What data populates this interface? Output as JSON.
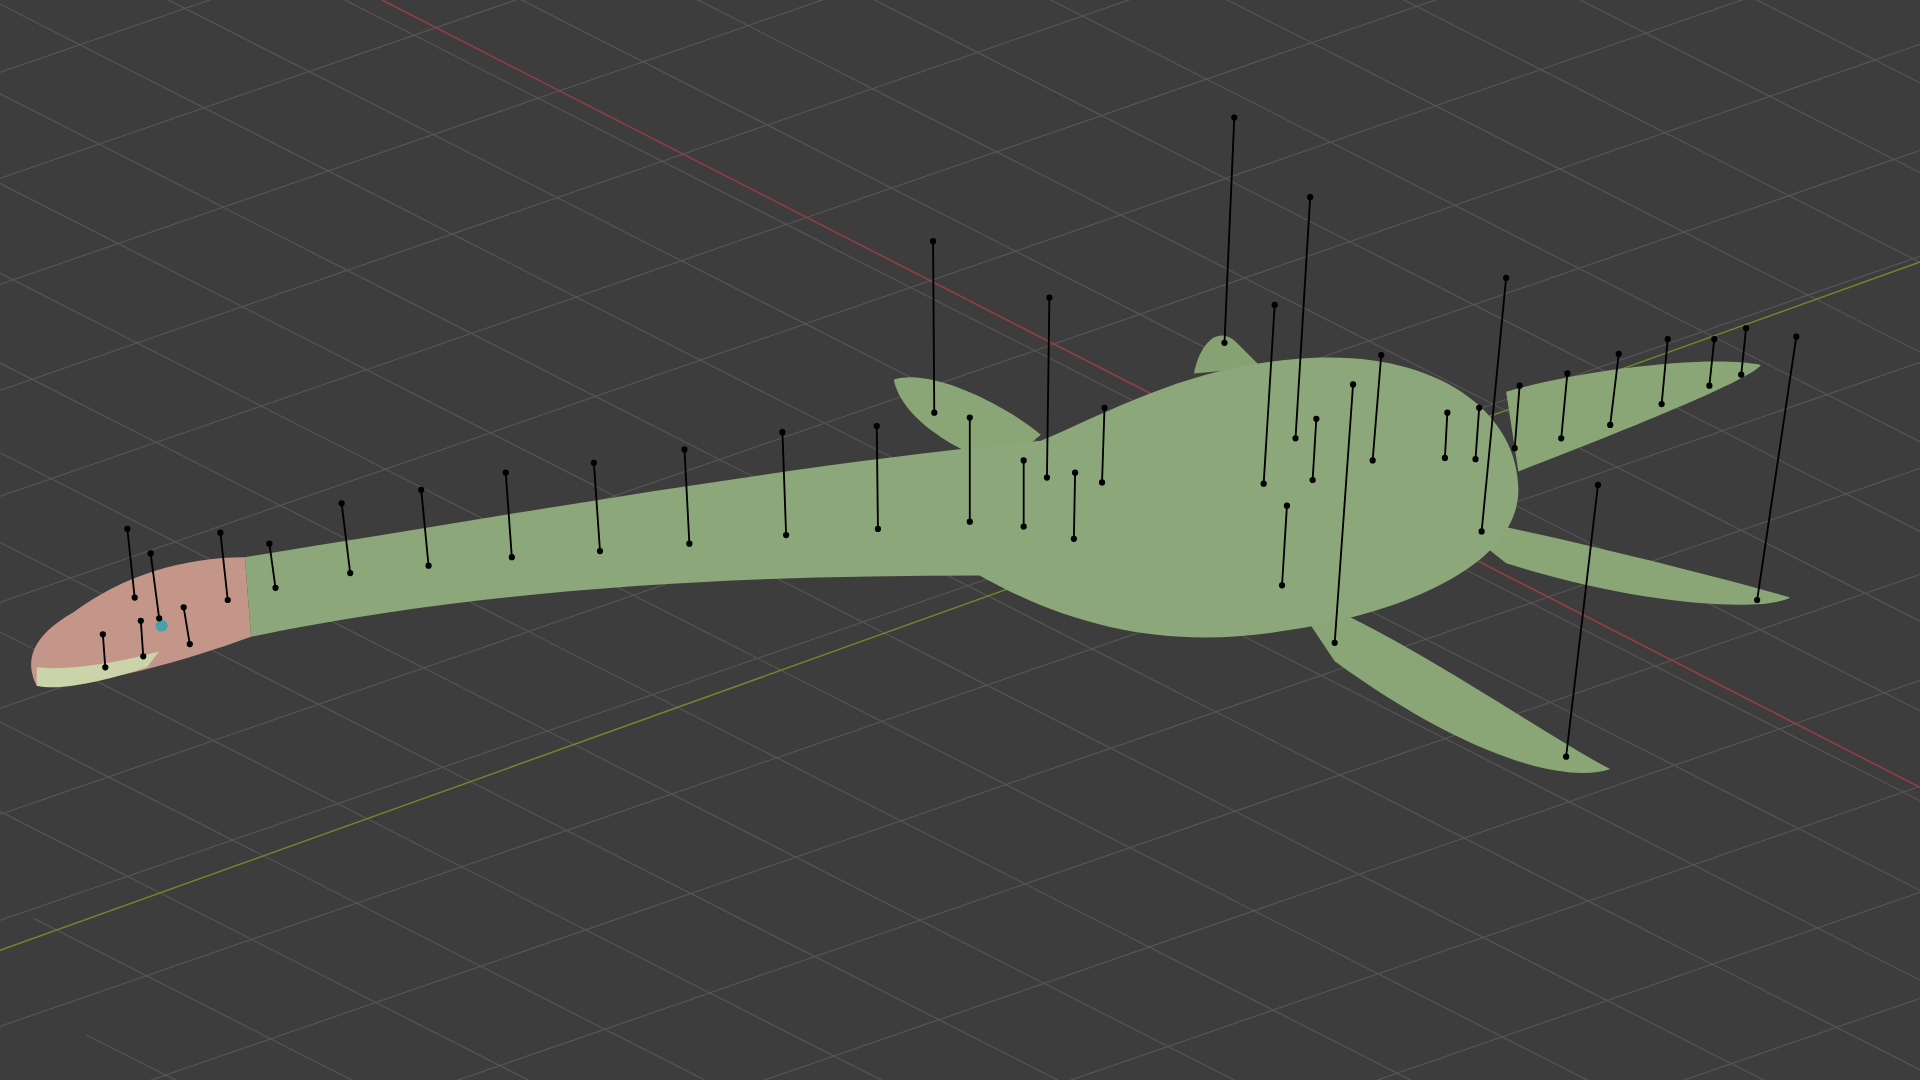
{
  "viewport": {
    "show_grid": true,
    "show_axes": true,
    "show_model": true
  }
}
